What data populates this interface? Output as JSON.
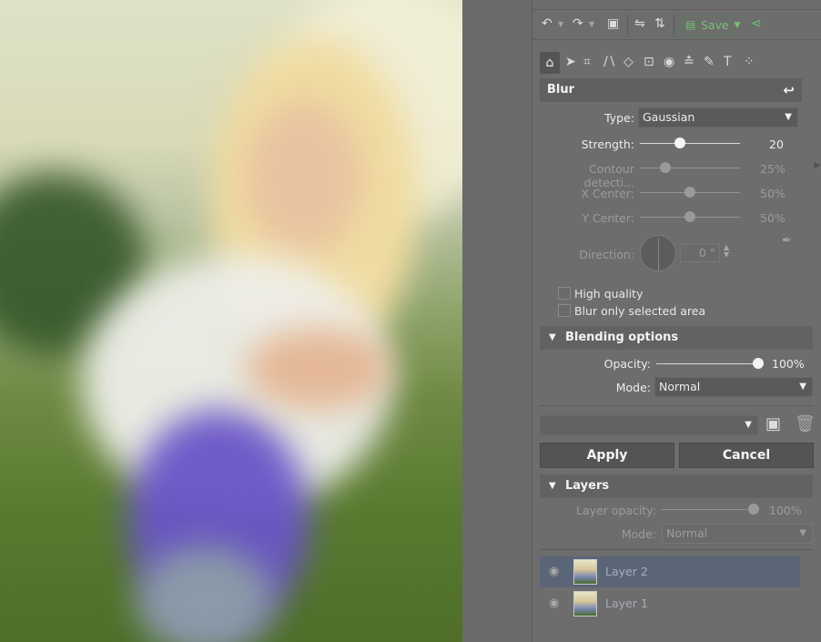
{
  "toolbar": {
    "save_label": "Save"
  },
  "blur": {
    "title": "Blur",
    "type_label": "Type:",
    "type_value": "Gaussian",
    "strength_label": "Strength:",
    "strength_value": "20",
    "strength_fraction": 0.4,
    "contour_label": "Contour detecti...",
    "contour_value": "25%",
    "contour_fraction": 0.25,
    "xcenter_label": "X Center:",
    "xcenter_value": "50%",
    "xcenter_fraction": 0.5,
    "ycenter_label": "Y Center:",
    "ycenter_value": "50%",
    "ycenter_fraction": 0.5,
    "direction_label": "Direction:",
    "direction_value": "0 °",
    "high_quality_label": "High quality",
    "high_quality_checked": false,
    "blur_selected_label": "Blur only selected area",
    "blur_selected_checked": false
  },
  "blending": {
    "title": "Blending options",
    "opacity_label": "Opacity:",
    "opacity_value": "100%",
    "opacity_fraction": 1.0,
    "mode_label": "Mode:",
    "mode_value": "Normal"
  },
  "preset": {
    "value": ""
  },
  "actions": {
    "apply_label": "Apply",
    "cancel_label": "Cancel"
  },
  "layers": {
    "title": "Layers",
    "opacity_label": "Layer opacity:",
    "opacity_value": "100%",
    "mode_label": "Mode:",
    "mode_value": "Normal",
    "items": [
      {
        "name": "Layer 2",
        "selected": true
      },
      {
        "name": "Layer 1",
        "selected": false
      }
    ]
  },
  "icons": {
    "undo": "undo-icon",
    "redo": "redo-icon",
    "image": "image-icon",
    "flip": "flip-icon",
    "save": "save-icon",
    "share": "share-icon",
    "home": "home-icon"
  },
  "colors": {
    "panel_bg": "#6d6d6d",
    "section_bg": "#606060",
    "save_green": "#77c077",
    "selected_layer": "#5a6577"
  }
}
